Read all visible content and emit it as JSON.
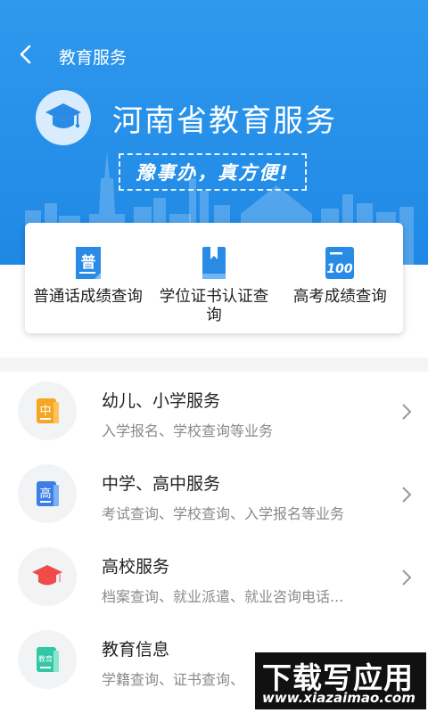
{
  "header": {
    "back_icon": "chevron-left-icon",
    "title": "教育服务"
  },
  "banner": {
    "logo_icon": "graduation-cap-icon",
    "title": "河南省教育服务",
    "slogan": "豫事办，真方便!"
  },
  "quick_services": [
    {
      "label": "普通话成绩查询",
      "icon": "document-pu-icon",
      "icon_text": "普"
    },
    {
      "label": "学位证书认证查询",
      "icon": "bookmark-book-icon"
    },
    {
      "label": "高考成绩查询",
      "icon": "score-100-icon",
      "icon_text": "100"
    }
  ],
  "services": [
    {
      "title": "幼儿、小学服务",
      "subtitle": "入学报名、学校查询等业务",
      "icon": "book-zhong-icon",
      "icon_text": "中",
      "color": "#f5a623"
    },
    {
      "title": "中学、高中服务",
      "subtitle": "考试查询、学校查询、入学报名等业务",
      "icon": "book-gao-icon",
      "icon_text": "高",
      "color": "#3b7fe6"
    },
    {
      "title": "高校服务",
      "subtitle": "档案查询、就业派遣、就业咨询电话...",
      "icon": "graduation-cap-icon",
      "color": "#ef4b4b"
    },
    {
      "title": "教育信息",
      "subtitle": "学籍查询、证书查询、",
      "icon": "book-jiaoyu-icon",
      "icon_text": "教育",
      "color": "#32c7a4"
    }
  ],
  "watermark": {
    "main": "下载写应用",
    "url": "www.xiazaimao.com"
  },
  "colors": {
    "primary": "#1e88e5",
    "text": "#222222",
    "subtext": "#8a8a8a"
  }
}
